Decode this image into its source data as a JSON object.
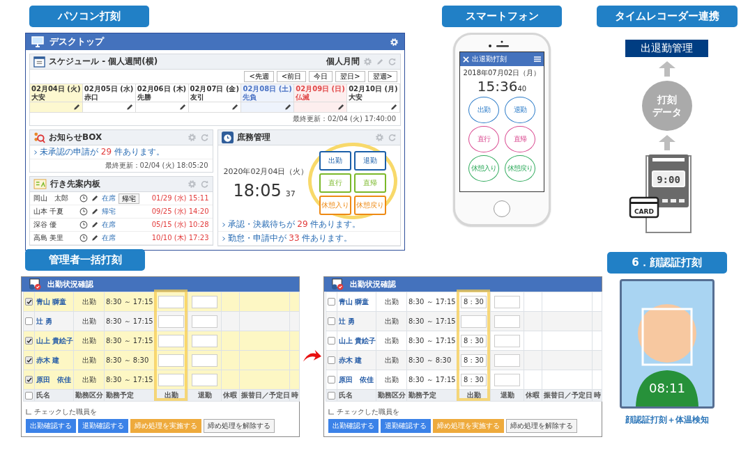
{
  "pc": {
    "heading": "パソコン打刻",
    "desktop": {
      "title": "デスクトップ",
      "schedule": {
        "title": "スケジュール - 個人週間(横)",
        "view_link": "個人月間",
        "nav_buttons": [
          "<先週",
          "<前日",
          "今日",
          "翌日>",
          "翌週>"
        ],
        "days": [
          {
            "label": "02月04日 (火) 大安",
            "kind": "today"
          },
          {
            "label": "02月05日 (水) 赤口",
            "kind": "weekday"
          },
          {
            "label": "02月06日 (木) 先勝",
            "kind": "weekday"
          },
          {
            "label": "02月07日 (金) 友引",
            "kind": "weekday"
          },
          {
            "label": "02月08日 (土) 先負",
            "kind": "saturday"
          },
          {
            "label": "02月09日 (日) 仏滅",
            "kind": "sunday"
          },
          {
            "label": "02月10日 (月) 大安",
            "kind": "weekday"
          }
        ],
        "last_updated": "最終更新：02/04 (火) 17:40:00"
      },
      "notice": {
        "title": "お知らせBOX",
        "message": {
          "before": "未承認の申請が",
          "count": "29",
          "after": "件あります。"
        },
        "last_updated": "最終更新：02/04 (火) 18:05:20"
      },
      "destinations": {
        "title": "行き先案内板",
        "rows": [
          {
            "name": "岡山　太郎",
            "status": "在席",
            "action": "帰宅",
            "time": "01/29 (水) 15:11"
          },
          {
            "name": "山本 千夏",
            "status": "帰宅",
            "time": "09/25 (水) 14:20"
          },
          {
            "name": "深谷 優",
            "status": "在席",
            "time": "05/15 (水) 10:28"
          },
          {
            "name": "高島 美里",
            "status": "在席",
            "time": "10/10 (木) 17:23"
          }
        ]
      },
      "attendance": {
        "title": "庶務管理",
        "date": "2020年02月04日（火）",
        "time": "18:05",
        "seconds": "37",
        "buttons": [
          {
            "label": "出勤",
            "color": "#1a5ea8"
          },
          {
            "label": "退勤",
            "color": "#1a5ea8"
          },
          {
            "label": "直行",
            "color": "#7ab829"
          },
          {
            "label": "直帰",
            "color": "#7ab829"
          },
          {
            "label": "休憩入り",
            "color": "#ee8a14"
          },
          {
            "label": "休憩戻り",
            "color": "#ee8a14"
          }
        ],
        "notices": [
          {
            "before": "承認・決裁待ちが",
            "count": "29",
            "after": "件あります。"
          },
          {
            "before": "勤怠・申請中が",
            "count": "33",
            "after": "件あります。"
          }
        ]
      }
    }
  },
  "smartphone": {
    "heading": "スマートフォン",
    "app_title": "出退勤打刻",
    "date": "2018年07月02日（月）",
    "time": "15:36",
    "seconds": "40",
    "buttons": [
      {
        "label": "出勤",
        "color": "#2b7bc8"
      },
      {
        "label": "退勤",
        "color": "#2b7bc8"
      },
      {
        "label": "直行",
        "color": "#d9478f"
      },
      {
        "label": "直帰",
        "color": "#d9478f"
      },
      {
        "label": "休憩入り",
        "color": "#2eaa5b"
      },
      {
        "label": "休憩戻り",
        "color": "#2eaa5b"
      }
    ]
  },
  "time_recorder": {
    "heading": "タイムレコーダー連携",
    "target": "出退勤管理",
    "data_label_lines": [
      "打刻",
      "データ"
    ],
    "display": "9:00",
    "card": "CARD"
  },
  "admin": {
    "heading": "管理者一括打刻",
    "tables": [
      {
        "title": "出勤状況確認",
        "header_checked": false,
        "columns": [
          "氏名",
          "勤務区分",
          "勤務予定",
          "出勤",
          "退勤",
          "休暇",
          "振替日／予定日",
          "時"
        ],
        "rows": [
          {
            "checked": true,
            "name": "青山 獅童",
            "type": "出勤",
            "schedule": "8:30 ～ 17:15"
          },
          {
            "checked": false,
            "name": "辻 勇",
            "type": "出勤",
            "schedule": "8:30 ～ 17:15"
          },
          {
            "checked": true,
            "name": "山上 貴絵子",
            "type": "出勤",
            "schedule": "8:30 ～ 17:15"
          },
          {
            "checked": true,
            "name": "赤木 建",
            "type": "出勤",
            "schedule": "8:30 ～ 8:30"
          },
          {
            "checked": true,
            "name": "原田　依佳",
            "type": "出勤",
            "schedule": "8:30 ～ 17:15"
          }
        ],
        "footer_label": "チェックした職員を",
        "actions": [
          {
            "label": "出勤確認する",
            "kind": "primary"
          },
          {
            "label": "退勤確認する",
            "kind": "primary"
          },
          {
            "label": "締め処理を実施する",
            "kind": "warning"
          },
          {
            "label": "締め処理を解除する",
            "kind": "default"
          }
        ]
      },
      {
        "title": "出勤状況確認",
        "header_checked": false,
        "columns": [
          "氏名",
          "勤務区分",
          "勤務予定",
          "出勤",
          "退勤",
          "休暇",
          "振替日／予定日",
          "時"
        ],
        "rows": [
          {
            "checked": false,
            "name": "青山 獅童",
            "type": "出勤",
            "schedule": "8:30 ～ 17:15",
            "clock_in": "8 : 30"
          },
          {
            "checked": false,
            "name": "辻 勇",
            "type": "出勤",
            "schedule": "8:30 ～ 17:15"
          },
          {
            "checked": false,
            "name": "山上 貴絵子",
            "type": "出勤",
            "schedule": "8:30 ～ 17:15",
            "clock_in": "8 : 30"
          },
          {
            "checked": false,
            "name": "赤木 建",
            "type": "出勤",
            "schedule": "8:30 ～ 8:30",
            "clock_in": "8 : 30"
          },
          {
            "checked": false,
            "name": "原田　依佳",
            "type": "出勤",
            "schedule": "8:30 ～ 17:15",
            "clock_in": "8 : 30"
          }
        ],
        "footer_label": "チェックした職員を",
        "actions": [
          {
            "label": "出勤確認する",
            "kind": "primary"
          },
          {
            "label": "退勤確認する",
            "kind": "primary"
          },
          {
            "label": "締め処理を実施する",
            "kind": "warning"
          },
          {
            "label": "締め処理を解除する",
            "kind": "default"
          }
        ]
      }
    ]
  },
  "face": {
    "heading": "6．顔認証打刻",
    "time": "08:11",
    "caption": "顔認証打刻＋体温検知"
  }
}
